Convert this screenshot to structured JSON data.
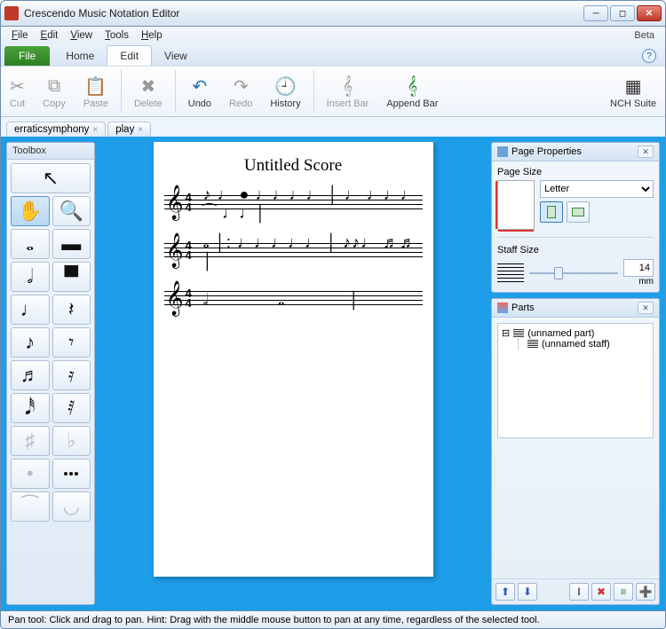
{
  "window": {
    "title": "Crescendo Music Notation Editor",
    "beta": "Beta"
  },
  "menubar": {
    "file": "File",
    "edit": "Edit",
    "view": "View",
    "tools": "Tools",
    "help": "Help"
  },
  "ribbon": {
    "file_tab": "File",
    "tabs": {
      "home": "Home",
      "edit": "Edit",
      "view": "View"
    },
    "buttons": {
      "cut": "Cut",
      "copy": "Copy",
      "paste": "Paste",
      "delete": "Delete",
      "undo": "Undo",
      "redo": "Redo",
      "history": "History",
      "insert_bar": "Insert Bar",
      "append_bar": "Append Bar",
      "nch_suite": "NCH Suite"
    }
  },
  "doctabs": {
    "tab1": "erraticsymphony",
    "tab2": "play"
  },
  "toolbox": {
    "title": "Toolbox"
  },
  "score": {
    "title": "Untitled Score",
    "timesig_top": "4",
    "timesig_bot": "4"
  },
  "page_props": {
    "title": "Page Properties",
    "page_size_label": "Page Size",
    "page_size_value": "Letter",
    "staff_size_label": "Staff Size",
    "staff_size_value": "14",
    "staff_size_unit": "mm"
  },
  "parts": {
    "title": "Parts",
    "root": "(unnamed part)",
    "child": "(unnamed staff)"
  },
  "statusbar": {
    "text": "Pan tool: Click and drag to pan. Hint: Drag with the middle mouse button to pan at any time, regardless of the selected tool."
  }
}
